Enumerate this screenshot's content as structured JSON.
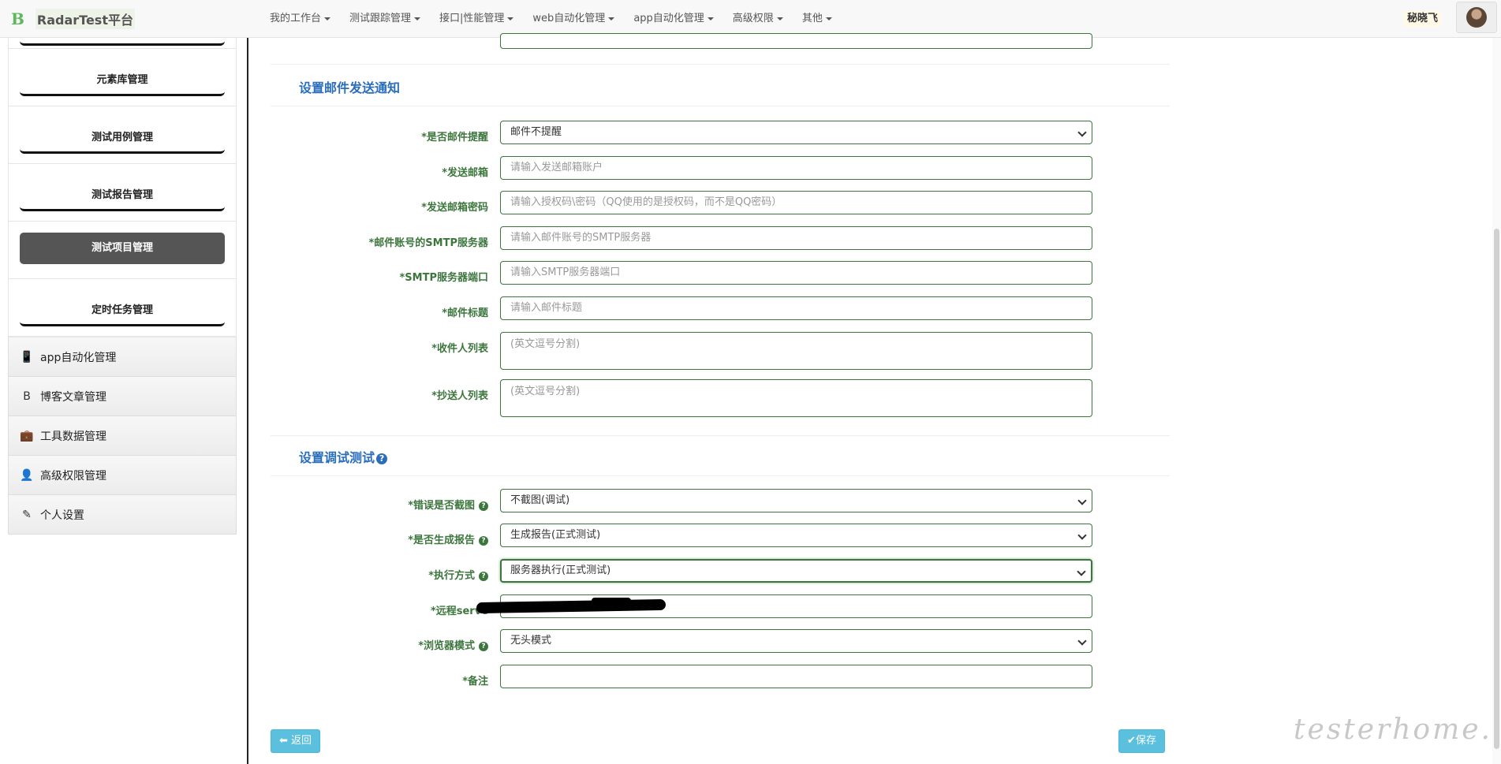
{
  "brand": {
    "icon": "B",
    "name": "RadarTest平台"
  },
  "nav": [
    {
      "label": "我的工作台"
    },
    {
      "label": "测试跟踪管理"
    },
    {
      "label": "接口|性能管理"
    },
    {
      "label": "web自动化管理"
    },
    {
      "label": "app自动化管理"
    },
    {
      "label": "高级权限"
    },
    {
      "label": "其他"
    }
  ],
  "user": {
    "name": "秘晓飞"
  },
  "sidebar": {
    "sub_items": [
      "",
      "元素库管理",
      "测试用例管理",
      "测试报告管理",
      "测试项目管理",
      "定时任务管理"
    ],
    "active_index": 4,
    "menu": [
      {
        "icon": "📱",
        "icon_name": "mobile-icon",
        "label": "app自动化管理"
      },
      {
        "icon": "B",
        "icon_name": "bold-b-icon",
        "label": "博客文章管理"
      },
      {
        "icon": "💼",
        "icon_name": "briefcase-icon",
        "label": "工具数据管理"
      },
      {
        "icon": "👤",
        "icon_name": "user-icon",
        "label": "高级权限管理"
      },
      {
        "icon": "✎",
        "icon_name": "edit-icon",
        "label": "个人设置"
      }
    ]
  },
  "email_section": {
    "title": "设置邮件发送通知",
    "fields": {
      "remind": {
        "label": "*是否邮件提醒",
        "value": "邮件不提醒"
      },
      "sender": {
        "label": "*发送邮箱",
        "placeholder": "请输入发送邮箱账户"
      },
      "password": {
        "label": "*发送邮箱密码",
        "placeholder": "请输入授权码\\密码（QQ使用的是授权码，而不是QQ密码）"
      },
      "smtp": {
        "label": "*邮件账号的SMTP服务器",
        "placeholder": "请输入邮件账号的SMTP服务器"
      },
      "port": {
        "label": "*SMTP服务器端口",
        "placeholder": "请输入SMTP服务器端口"
      },
      "subject": {
        "label": "*邮件标题",
        "placeholder": "请输入邮件标题"
      },
      "to": {
        "label": "*收件人列表",
        "placeholder": "(英文逗号分割)"
      },
      "cc": {
        "label": "*抄送人列表",
        "placeholder": "(英文逗号分割)"
      }
    }
  },
  "debug_section": {
    "title": "设置调试测试",
    "fields": {
      "screenshot": {
        "label": "*错误是否截图",
        "value": "不截图(调试)"
      },
      "report": {
        "label": "*是否生成报告",
        "value": "生成报告(正式测试)"
      },
      "exec": {
        "label": "*执行方式",
        "value": "服务器执行(正式测试)"
      },
      "remote": {
        "label": "*远程serve"
      },
      "browser": {
        "label": "*浏览器模式",
        "value": "无头模式"
      },
      "note": {
        "label": "*备注"
      }
    }
  },
  "buttons": {
    "back": "返回",
    "save": "保存"
  },
  "watermark": "testerhome.com"
}
